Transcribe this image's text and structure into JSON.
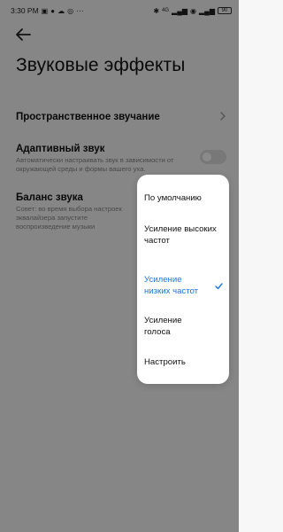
{
  "status_bar": {
    "time": "3:30 PM",
    "left_icons": [
      "sim-icon",
      "chat-icon",
      "cloud-icon",
      "instagram-icon"
    ],
    "more": "···",
    "bluetooth": "✱",
    "network": "4G",
    "battery": "90"
  },
  "header": {
    "title": "Звуковые эффекты"
  },
  "settings": [
    {
      "title": "Пространственное звучание",
      "description": ""
    },
    {
      "title": "Адаптивный звук",
      "description": "Автоматически настраивать звук в зависимости от окружающей среды и формы вашего уха."
    },
    {
      "title": "Баланс звука",
      "description": "Совет: во время выбора настроек эквалайзера запустите воспроизведение музыки"
    }
  ],
  "toggle_adaptive": false,
  "dropdown": {
    "options": [
      {
        "label": "По умолчанию",
        "selected": false
      },
      {
        "label": "Усиление высоких частот",
        "selected": false
      },
      {
        "label": "Усиление низких частот",
        "selected": true
      },
      {
        "label": "Усиление голоса",
        "selected": false
      },
      {
        "label": "Настроить",
        "selected": false
      }
    ]
  },
  "colors": {
    "accent": "#1b76e8",
    "overlay": "rgba(0,0,0,0.46)"
  }
}
